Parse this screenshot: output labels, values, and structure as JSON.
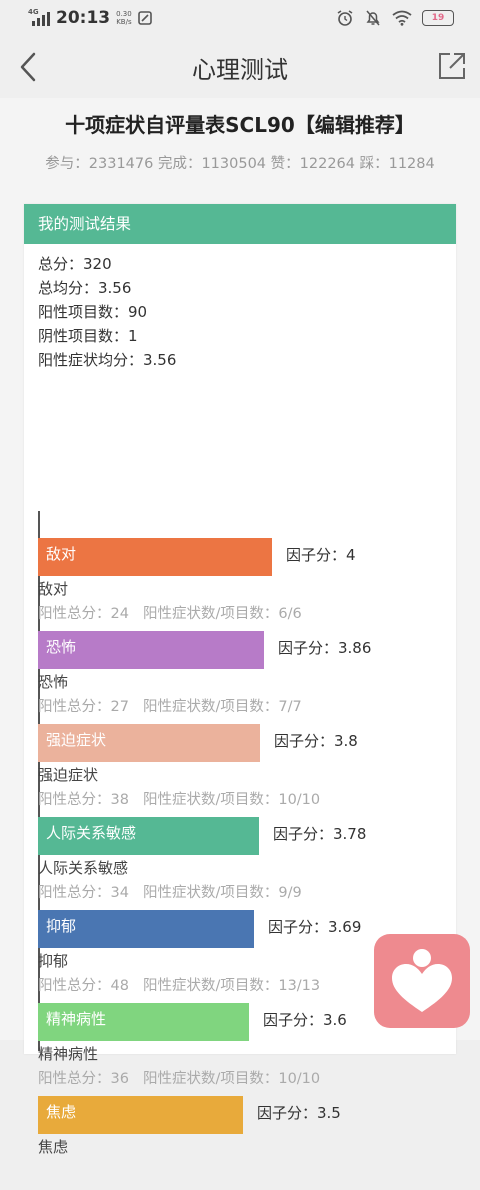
{
  "status_bar": {
    "network": "4G",
    "time": "20:13",
    "speed_value": "0.30",
    "speed_unit": "KB/s",
    "battery": "19"
  },
  "header": {
    "title": "心理测试"
  },
  "test": {
    "title": "十项症状自评量表SCL90【编辑推荐】",
    "stats": "参与：2331476 完成：1130504 赞：122264 踩：11284"
  },
  "result": {
    "header": "我的测试结果",
    "total": "总分：320",
    "avg": "总均分：3.56",
    "positive_items": "阳性项目数：90",
    "negative_items": "阴性项目数：1",
    "positive_avg": "阳性症状均分：3.56"
  },
  "colors": {
    "accent": "#55b894",
    "fab": "#ee8a8f"
  },
  "factors": [
    {
      "label": "敌对",
      "name": "敌对",
      "score": "因子分：4",
      "value": 4,
      "color": "#ec7543",
      "total": "阳性总分：24",
      "count": "阳性症状数/项目数：6/6"
    },
    {
      "label": "恐怖",
      "name": "恐怖",
      "score": "因子分：3.86",
      "value": 3.86,
      "color": "#b77bc8",
      "total": "阳性总分：27",
      "count": "阳性症状数/项目数：7/7"
    },
    {
      "label": "强迫症状",
      "name": "强迫症状",
      "score": "因子分：3.8",
      "value": 3.8,
      "color": "#ebb29c",
      "total": "阳性总分：38",
      "count": "阳性症状数/项目数：10/10"
    },
    {
      "label": "人际关系敏感",
      "name": "人际关系敏感",
      "score": "因子分：3.78",
      "value": 3.78,
      "color": "#55b894",
      "total": "阳性总分：34",
      "count": "阳性症状数/项目数：9/9"
    },
    {
      "label": "抑郁",
      "name": "抑郁",
      "score": "因子分：3.69",
      "value": 3.69,
      "color": "#4a76b2",
      "total": "阳性总分：48",
      "count": "阳性症状数/项目数：13/13"
    },
    {
      "label": "精神病性",
      "name": "精神病性",
      "score": "因子分：3.6",
      "value": 3.6,
      "color": "#80d57f",
      "total": "阳性总分：36",
      "count": "阳性症状数/项目数：10/10"
    },
    {
      "label": "焦虑",
      "name": "焦虑",
      "score": "因子分：3.5",
      "value": 3.5,
      "color": "#e8aa3b",
      "total": "",
      "count": ""
    }
  ]
}
